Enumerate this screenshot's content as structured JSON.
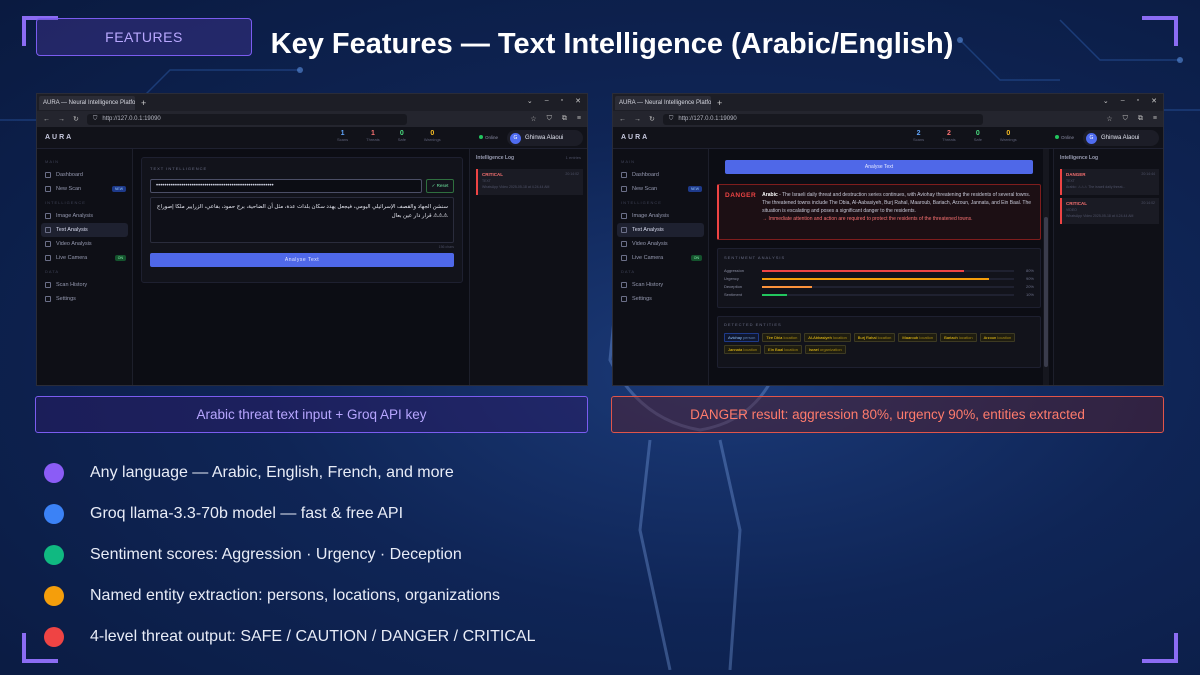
{
  "header": {
    "badge": "FEATURES",
    "title": "Key Features — Text Intelligence (Arabic/English)"
  },
  "browser": {
    "tab_title": "AURA — Neural Intelligence Platfor",
    "url": "http://127.0.0.1:19090"
  },
  "app": {
    "logo": "AURA",
    "stats": [
      {
        "value": "1",
        "label": "Scans",
        "color": "#60a5fa"
      },
      {
        "value": "1",
        "label": "Threats",
        "color": "#f87171"
      },
      {
        "value": "0",
        "label": "Safe",
        "color": "#4ade80"
      },
      {
        "value": "0",
        "label": "Warnings",
        "color": "#fbbf24"
      }
    ],
    "stats_right": [
      {
        "value": "2",
        "label": "Scans",
        "color": "#60a5fa"
      },
      {
        "value": "2",
        "label": "Threats",
        "color": "#f87171"
      },
      {
        "value": "0",
        "label": "Safe",
        "color": "#4ade80"
      },
      {
        "value": "0",
        "label": "Warnings",
        "color": "#fbbf24"
      }
    ],
    "online": "Online",
    "user_initial": "G",
    "user_name": "Ghinwa Alaoui",
    "sidebar": {
      "sections": [
        "MAIN",
        "INTELLIGENCE",
        "DATA"
      ],
      "items": [
        {
          "label": "Dashboard",
          "icon": "dashboard-icon"
        },
        {
          "label": "New Scan",
          "icon": "scan-icon",
          "pill": "NEW"
        },
        {
          "label": "Image Analysis",
          "icon": "image-icon"
        },
        {
          "label": "Text Analysis",
          "icon": "text-icon"
        },
        {
          "label": "Video Analysis",
          "icon": "video-icon"
        },
        {
          "label": "Live Camera",
          "icon": "camera-icon",
          "pill": "ON"
        },
        {
          "label": "Scan History",
          "icon": "history-icon"
        },
        {
          "label": "Settings",
          "icon": "settings-icon"
        }
      ]
    },
    "text_panel": {
      "label": "TEXT INTELLIGENCE",
      "api_key": "••••••••••••••••••••••••••••••••••••••••••••••••••••••••",
      "reset": "✓ Reset",
      "arabic_text": "سنشن الجهاد والقصف الإسرائيلي اليومي، فيجعل يهدد سكان بلدات عدة، مثل أن الضاحية، برج حمود، بقاعي، الزرايير ملكا إصوراج ⚠⚠⚠ قرار دار عين بعال",
      "char_count": "156 chars",
      "analyze": "Analyse Text"
    },
    "log": {
      "title": "Intelligence Log",
      "count": "1 entries",
      "entries_left": [
        {
          "level": "CRITICAL",
          "type": "TEXT",
          "time": "20:14:02",
          "detail": "WhatsApp Video 2025-05-18 at 4.24.44 AM"
        }
      ],
      "entries_right": [
        {
          "level": "DANGER",
          "type": "TEXT",
          "time": "20:14:44",
          "detail": "Arabic: ⚠⚠⚠ The israeli daily threat..."
        },
        {
          "level": "CRITICAL",
          "type": "VIDEO",
          "time": "20:14:02",
          "detail": "WhatsApp Video 2025-05-18 at 4.24.44 AM"
        }
      ]
    },
    "result": {
      "tag": "DANGER",
      "lang": "Arabic",
      "summary": " - The Israeli daily threat and destruction series continues, with Aviohay threatening the residents of several towns. The threatened towns include The Dbia, Al-Aabasiyeh, Burj Rahal, Maaroub, Bariach, Arzoun, Jannata, and Ein Baal. The situation is escalating and poses a significant danger to the residents.",
      "recommendation": "→ Immediate attention and action are required to protect the residents of the threatened towns.",
      "sentiment_label": "SENTIMENT ANALYSIS",
      "sentiment": [
        {
          "name": "Aggression",
          "value": 80,
          "display": "80%",
          "color": "#ef4444"
        },
        {
          "name": "Urgency",
          "value": 90,
          "display": "90%",
          "color": "#f59e0b"
        },
        {
          "name": "Deception",
          "value": 20,
          "display": "20%",
          "color": "#fb923c"
        },
        {
          "name": "Sentiment",
          "value": 10,
          "display": "10%",
          "color": "#22c55e"
        }
      ],
      "entities_label": "DETECTED ENTITIES",
      "entities": [
        {
          "name": "Avichay",
          "type": "person"
        },
        {
          "name": "Tire Dbia",
          "type": "location"
        },
        {
          "name": "Al-Abbasiyeh",
          "type": "location"
        },
        {
          "name": "Burj Rahal",
          "type": "location"
        },
        {
          "name": "Maaroub",
          "type": "location"
        },
        {
          "name": "Bariach",
          "type": "location"
        },
        {
          "name": "Arzoun",
          "type": "location"
        },
        {
          "name": "Jannata",
          "type": "location"
        },
        {
          "name": "Ein Baal",
          "type": "location"
        },
        {
          "name": "Israel",
          "type": "organization"
        }
      ]
    }
  },
  "captions": {
    "left": "Arabic threat text input + Groq API key",
    "right": "DANGER result: aggression 80%, urgency 90%, entities extracted"
  },
  "bullets": [
    {
      "text": "Any language — Arabic, English, French, and more",
      "color": "#8b5cf6"
    },
    {
      "text": "Groq llama-3.3-70b model — fast & free API",
      "color": "#3b82f6"
    },
    {
      "text": "Sentiment scores: Aggression · Urgency · Deception",
      "color": "#10b981"
    },
    {
      "text": "Named entity extraction: persons, locations, organizations",
      "color": "#f59e0b"
    },
    {
      "text": "4-level threat output: SAFE / CAUTION / DANGER / CRITICAL",
      "color": "#ef4444"
    }
  ]
}
